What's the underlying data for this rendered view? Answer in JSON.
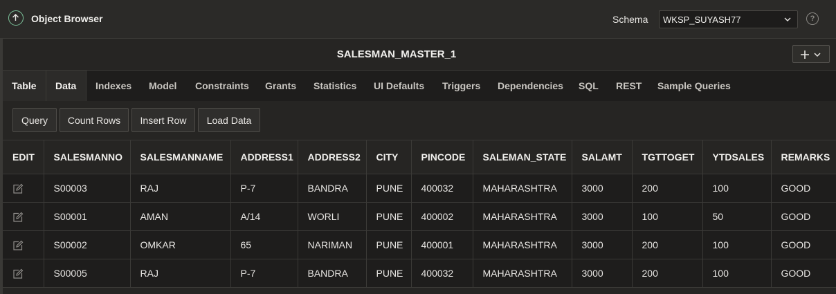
{
  "header": {
    "title": "Object Browser",
    "schema_label": "Schema",
    "schema_value": "WKSP_SUYASH77",
    "help_symbol": "?"
  },
  "object": {
    "name": "SALESMAN_MASTER_1"
  },
  "tabs": [
    {
      "label": "Table"
    },
    {
      "label": "Data"
    },
    {
      "label": "Indexes"
    },
    {
      "label": "Model"
    },
    {
      "label": "Constraints"
    },
    {
      "label": "Grants"
    },
    {
      "label": "Statistics"
    },
    {
      "label": "UI Defaults"
    },
    {
      "label": "Triggers"
    },
    {
      "label": "Dependencies"
    },
    {
      "label": "SQL"
    },
    {
      "label": "REST"
    },
    {
      "label": "Sample Queries"
    }
  ],
  "toolbar": {
    "query": "Query",
    "count_rows": "Count Rows",
    "insert_row": "Insert Row",
    "load_data": "Load Data"
  },
  "table": {
    "columns": [
      "EDIT",
      "SALESMANNO",
      "SALESMANNAME",
      "ADDRESS1",
      "ADDRESS2",
      "CITY",
      "PINCODE",
      "SALEMAN_STATE",
      "SALAMT",
      "TGTTOGET",
      "YTDSALES",
      "REMARKS"
    ],
    "rows": [
      [
        "",
        "S00003",
        "RAJ",
        "P-7",
        "BANDRA",
        "PUNE",
        "400032",
        "MAHARASHTRA",
        "3000",
        "200",
        "100",
        "GOOD"
      ],
      [
        "",
        "S00001",
        "AMAN",
        "A/14",
        "WORLI",
        "PUNE",
        "400002",
        "MAHARASHTRA",
        "3000",
        "100",
        "50",
        "GOOD"
      ],
      [
        "",
        "S00002",
        "OMKAR",
        "65",
        "NARIMAN",
        "PUNE",
        "400001",
        "MAHARASHTRA",
        "3000",
        "200",
        "100",
        "GOOD"
      ],
      [
        "",
        "S00005",
        "RAJ",
        "P-7",
        "BANDRA",
        "PUNE",
        "400032",
        "MAHARASHTRA",
        "3000",
        "200",
        "100",
        "GOOD"
      ]
    ]
  },
  "colors": {
    "accent": "#7cc29a",
    "background": "#262523",
    "row_background": "#1e1d1c"
  },
  "icons": {
    "back": "arrow-up-circle-icon",
    "dropdown": "chevron-down-icon",
    "help": "help-circle-icon",
    "add": "plus-icon",
    "edit": "edit-pencil-icon"
  }
}
